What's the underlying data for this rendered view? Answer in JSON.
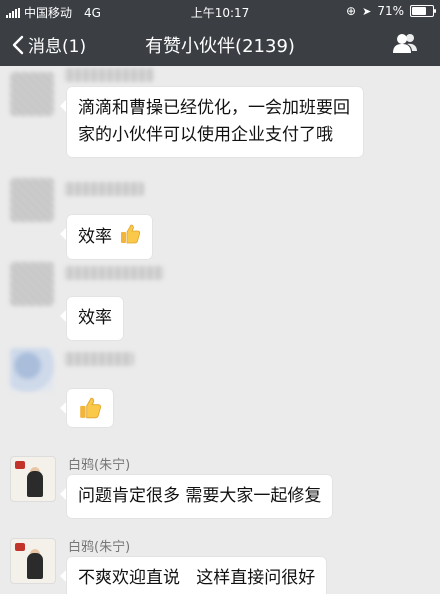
{
  "status_bar": {
    "carrier": "中国移动",
    "network": "4G",
    "time": "上午10:17",
    "battery": "71%",
    "battery_level": 0.71
  },
  "nav": {
    "back_label": "消息(1)",
    "title": "有赞小伙伴(2139)",
    "group_icon": "group-members-icon"
  },
  "messages": [
    {
      "text": "滴滴和曹操已经优化，一会加班要回家的小伙伴可以使用企业支付了哦"
    },
    {
      "text": "效率",
      "emoji": "thumbs-up-icon"
    },
    {
      "text": "效率"
    },
    {
      "text": "",
      "emoji": "thumbs-up-icon"
    },
    {
      "sender": "白鸦(朱宁)",
      "text": "问题肯定很多 需要大家一起修复"
    },
    {
      "sender": "白鸦(朱宁)",
      "text": "不爽欢迎直说   这样直接问很好"
    }
  ],
  "colors": {
    "nav_bg": "#3b3f44",
    "chat_bg": "#ebebeb",
    "bubble_bg": "#ffffff"
  }
}
